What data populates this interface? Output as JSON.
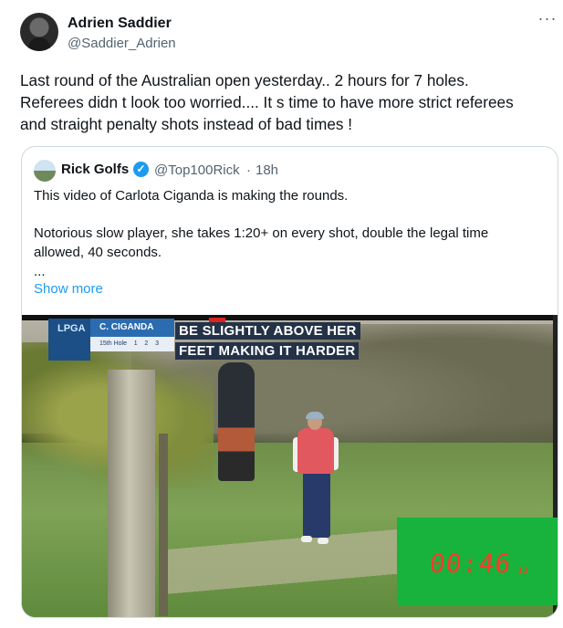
{
  "tweet": {
    "author_name": "Adrien Saddier",
    "author_handle": "@Saddier_Adrien",
    "more_icon": "more-horizontal-icon",
    "text_lines": [
      "Last round of the Australian open yesterday.. 2 hours for 7 holes.",
      "Referees didn t look too worried.... It s time to have more strict referees",
      "and straight penalty shots instead of bad times !"
    ]
  },
  "quote": {
    "author_name": "Rick Golfs",
    "verified_icon": "verified-badge-icon",
    "verified_glyph": "✓",
    "author_handle": "@Top100Rick",
    "separator": "·",
    "time": "18h",
    "paragraphs": [
      "This video of Carlota Ciganda is making the rounds.",
      "Notorious slow player, she takes 1:20+ on every shot, double the legal time",
      "allowed, 40 seconds.",
      "..."
    ],
    "show_more": "Show more"
  },
  "video": {
    "scorebug": {
      "logo_text": "LPGA",
      "player": "C. CIGANDA",
      "hole_line": "15th Hole    1    2    3"
    },
    "subtitle_line1": "BE SLIGHTLY ABOVE HER",
    "subtitle_line2": "FEET MAKING IT HARDER",
    "timer": "00:46",
    "timer_frames": "13"
  }
}
